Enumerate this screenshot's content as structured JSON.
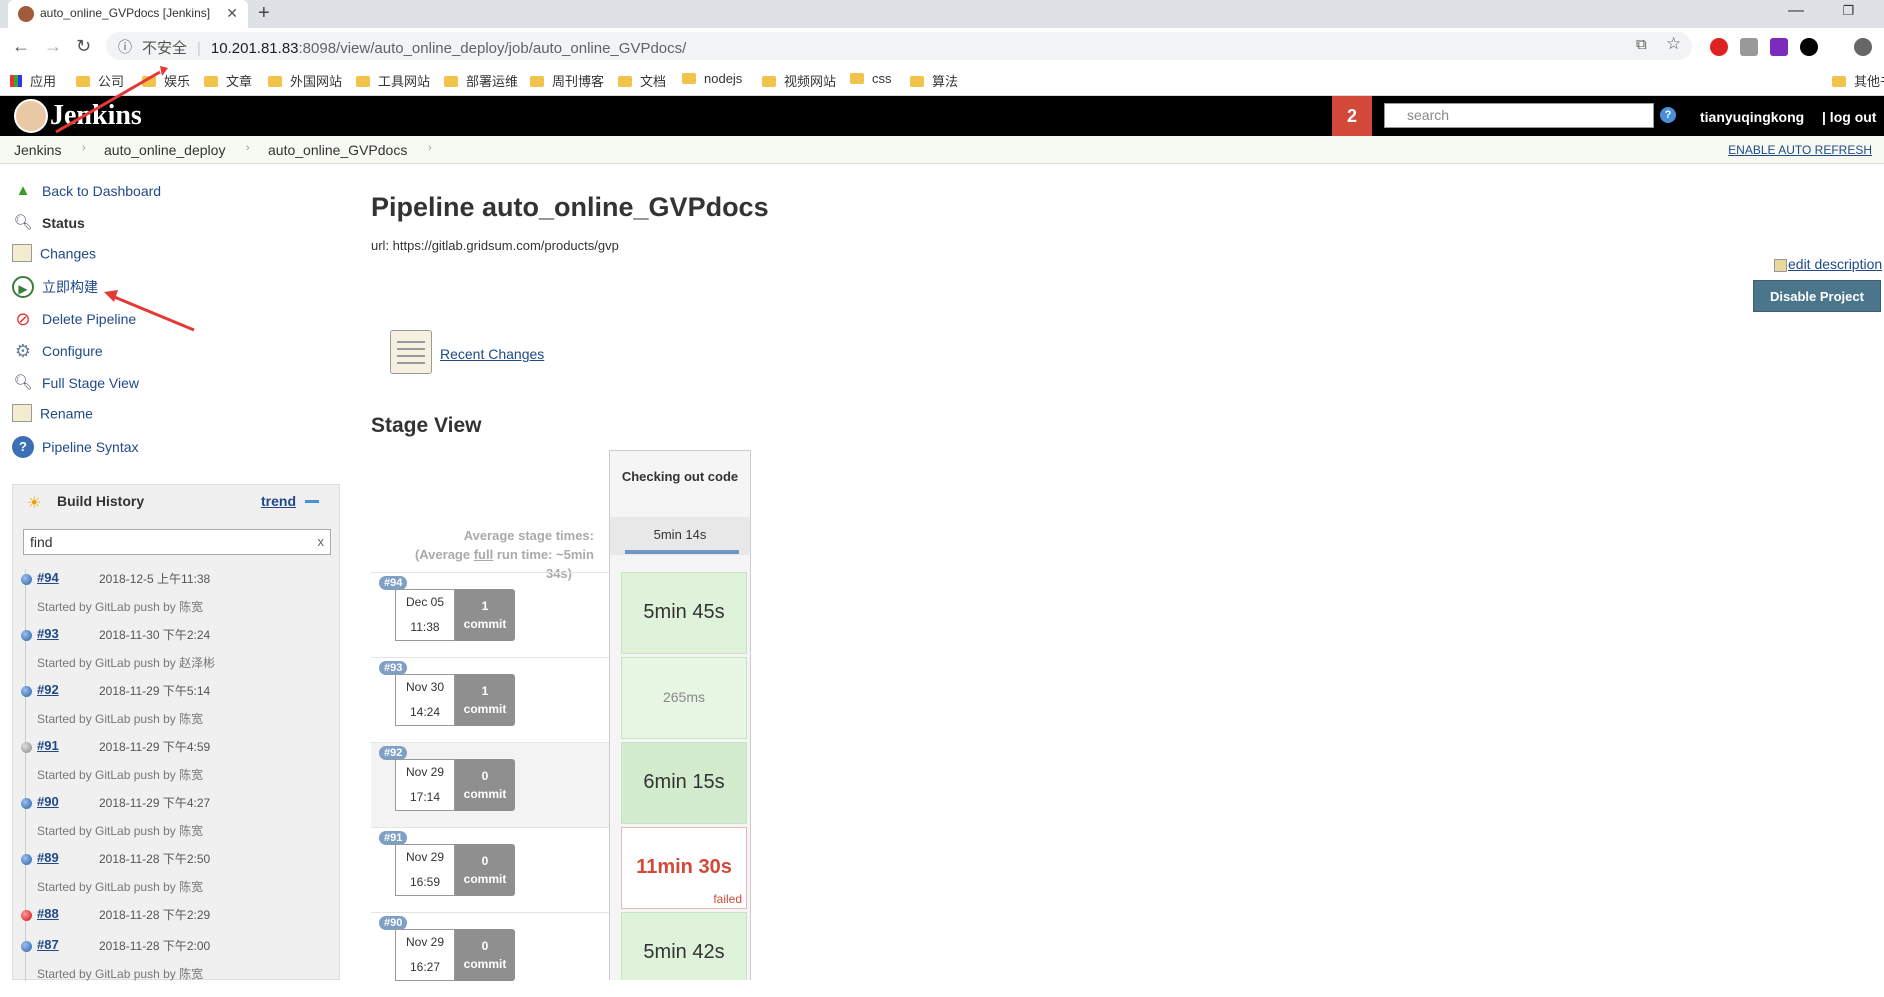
{
  "browser": {
    "tab_title": "auto_online_GVPdocs [Jenkins]",
    "url_insecure": "不安全",
    "url_host": "10.201.81.83",
    "url_path": ":8098/view/auto_online_deploy/job/auto_online_GVPdocs/",
    "bookmarks": [
      "应用",
      "公司",
      "娱乐",
      "文章",
      "外国网站",
      "工具网站",
      "部署运维",
      "周刊博客",
      "文档",
      "nodejs",
      "视频网站",
      "css",
      "算法",
      "其他书"
    ]
  },
  "jenkins": {
    "title": "Jenkins",
    "badge": "2",
    "search_placeholder": "search",
    "help": "?",
    "user": "tianyuqingkong",
    "logout": "| log out"
  },
  "breadcrumbs": [
    "Jenkins",
    "auto_online_deploy",
    "auto_online_GVPdocs"
  ],
  "auto_refresh": "ENABLE AUTO REFRESH",
  "sidebar": {
    "tasks": [
      {
        "label": "Back to Dashboard",
        "icon": "up-arrow-icon"
      },
      {
        "label": "Status",
        "icon": "magnifier-icon"
      },
      {
        "label": "Changes",
        "icon": "notepad-icon"
      },
      {
        "label": "立即构建",
        "icon": "build-clock-icon"
      },
      {
        "label": "Delete Pipeline",
        "icon": "no-entry-icon"
      },
      {
        "label": "Configure",
        "icon": "gear-icon"
      },
      {
        "label": "Full Stage View",
        "icon": "magnifier-icon"
      },
      {
        "label": "Rename",
        "icon": "notepad-icon"
      },
      {
        "label": "Pipeline Syntax",
        "icon": "help-icon"
      }
    ]
  },
  "build_history": {
    "title": "Build History",
    "trend": "trend",
    "find_value": "find",
    "builds": [
      {
        "num": "#94",
        "date": "2018-12-5 上午11:38",
        "started": "Started by GitLab push by 陈宽",
        "status": "blue"
      },
      {
        "num": "#93",
        "date": "2018-11-30 下午2:24",
        "started": "Started by GitLab push by 赵泽彬",
        "status": "blue"
      },
      {
        "num": "#92",
        "date": "2018-11-29 下午5:14",
        "started": "Started by GitLab push by 陈宽",
        "status": "blue"
      },
      {
        "num": "#91",
        "date": "2018-11-29 下午4:59",
        "started": "Started by GitLab push by 陈宽",
        "status": "grey"
      },
      {
        "num": "#90",
        "date": "2018-11-29 下午4:27",
        "started": "Started by GitLab push by 陈宽",
        "status": "blue"
      },
      {
        "num": "#89",
        "date": "2018-11-28 下午2:50",
        "started": "Started by GitLab push by 陈宽",
        "status": "blue"
      },
      {
        "num": "#88",
        "date": "2018-11-28 下午2:29",
        "started": "",
        "status": "red"
      },
      {
        "num": "#87",
        "date": "2018-11-28 下午2:00",
        "started": "Started by GitLab push by 陈宽",
        "status": "blue"
      }
    ]
  },
  "main": {
    "title": "Pipeline auto_online_GVPdocs",
    "url_text": "url: https://gitlab.gridsum.com/products/gvp",
    "edit_description": "edit description",
    "disable_project": "Disable Project",
    "recent_changes": "Recent Changes",
    "stage_view_title": "Stage View"
  },
  "stage_view": {
    "avg_label_1": "Average stage times:",
    "avg_label_2a": "(Average ",
    "avg_label_2b": "full",
    "avg_label_2c": " run time: ~5min",
    "avg_label_3": "34s)",
    "stage_name": "Checking out code",
    "stage_avg": "5min 14s",
    "runs": [
      {
        "badge": "#94",
        "month_day": "Dec 05",
        "time": "11:38",
        "commits_n": "1",
        "commits_label": "commit",
        "duration": "5min 45s",
        "status": "success"
      },
      {
        "badge": "#93",
        "month_day": "Nov 30",
        "time": "14:24",
        "commits_n": "1",
        "commits_label": "commit",
        "duration": "265ms",
        "status": "success-fast"
      },
      {
        "badge": "#92",
        "month_day": "Nov 29",
        "time": "17:14",
        "commits_n": "0",
        "commits_label": "commit",
        "duration": "6min 15s",
        "status": "success"
      },
      {
        "badge": "#91",
        "month_day": "Nov 29",
        "time": "16:59",
        "commits_n": "0",
        "commits_label": "commit",
        "duration": "11min 30s",
        "status": "failed",
        "status_text": "failed"
      },
      {
        "badge": "#90",
        "month_day": "Nov 29",
        "time": "16:27",
        "commits_n": "0",
        "commits_label": "commit",
        "duration": "5min 42s",
        "status": "success"
      }
    ]
  },
  "colors": {
    "jenkins_header": "#000000",
    "badge_red": "#d24939",
    "link_blue": "#204a87",
    "disable_btn": "#4b758b",
    "stage_success": "#def2d9",
    "stage_failed_text": "#d24939"
  }
}
